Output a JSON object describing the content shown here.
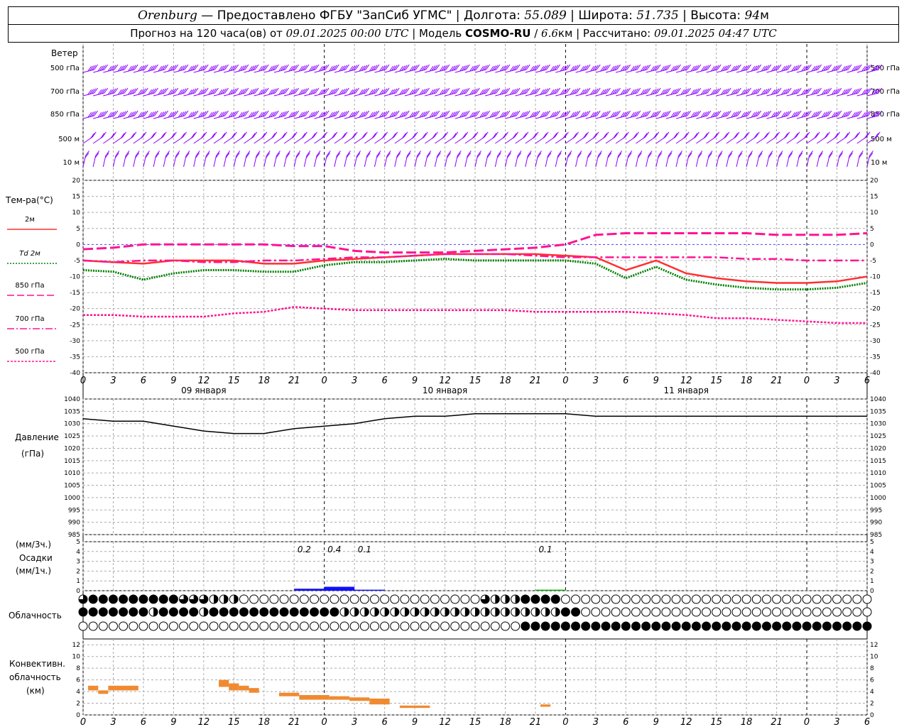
{
  "header": {
    "city": "Orenburg",
    "dash": " — ",
    "provider": "Предоставлено ФГБУ \"ЗапСиб УГМС\"",
    "sep": " | ",
    "lon_label": "Долгота: ",
    "lon": "55.089",
    "lat_label": "Широта: ",
    "lat": "51.735",
    "alt_label": "Высота: ",
    "alt": "94",
    "alt_unit": "м",
    "forecast_label": "Прогноз на 120 часа(ов) от ",
    "forecast_from": "09.01.2025 00:00 UTC",
    "model_label": " | Модель ",
    "model": "COSMO-RU",
    "model_slash": " / ",
    "model_res": "6.6",
    "model_res_unit": "км",
    "calc_label": " | Рассчитано: ",
    "calc_time": "09.01.2025 04:47 UTC"
  },
  "wind_panel": {
    "title": "Ветер",
    "levels": [
      "500 гПа",
      "700 гПа",
      "850 гПа",
      "500 м",
      "10   м"
    ],
    "color": "#8b00ff"
  },
  "temp_panel": {
    "title": "Тем-ра(°C)",
    "legend": [
      {
        "label": "2м",
        "color": "#ff3030",
        "style": "solid"
      },
      {
        "label": "Td  2м",
        "color": "#008000",
        "style": "dotted"
      },
      {
        "label": "850 гПа",
        "color": "#ff1493",
        "style": "longdash"
      },
      {
        "label": "700 гПа",
        "color": "#ff1493",
        "style": "dashdot"
      },
      {
        "label": "500 гПа",
        "color": "#ff1493",
        "style": "dense"
      }
    ],
    "yticks": [
      20,
      15,
      10,
      5,
      0,
      -5,
      -10,
      -15,
      -20,
      -25,
      -30,
      -35,
      -40
    ],
    "day_labels": [
      "09 января",
      "10 января",
      "11 января"
    ]
  },
  "pressure_panel": {
    "title": "Давление",
    "unit": "(гПа)",
    "yticks": [
      1040,
      1035,
      1030,
      1025,
      1020,
      1015,
      1010,
      1005,
      1000,
      995,
      990,
      985
    ]
  },
  "precip_panel": {
    "unit3": "(мм/3ч.)",
    "title": "Осадки",
    "unit1": "(мм/1ч.)",
    "yticks": [
      5,
      4,
      3,
      2,
      1,
      0
    ],
    "annotations": [
      {
        "hour": 22,
        "text": "0.2"
      },
      {
        "hour": 25,
        "text": "0.4"
      },
      {
        "hour": 28,
        "text": "0.1"
      },
      {
        "hour": 46,
        "text": "0.1"
      }
    ]
  },
  "cloud_panel": {
    "title": "Облачность"
  },
  "conv_panel": {
    "title1": "Конвективн.",
    "title2": "облачность",
    "unit": "(км)",
    "yticks": [
      12,
      10,
      8,
      6,
      4,
      2,
      0
    ]
  },
  "xaxis": {
    "tick_labels": [
      "0",
      "3",
      "6",
      "9",
      "12",
      "15",
      "18",
      "21",
      "0",
      "3",
      "6",
      "9",
      "12",
      "15",
      "18",
      "21",
      "0",
      "3",
      "6",
      "9",
      "12",
      "15",
      "18",
      "21",
      "0",
      "3",
      "6"
    ]
  },
  "chart_data": {
    "type": "line",
    "x_hours": [
      0,
      3,
      6,
      9,
      12,
      15,
      18,
      21,
      24,
      27,
      30,
      33,
      36,
      39,
      42,
      45,
      48,
      51,
      54,
      57,
      60,
      63,
      66,
      69,
      72,
      75,
      78
    ],
    "series": [
      {
        "name": "2м",
        "values": [
          -5,
          -5.5,
          -6,
          -5,
          -5,
          -5,
          -6,
          -6,
          -5,
          -4.5,
          -4,
          -3.5,
          -3,
          -3,
          -3,
          -3,
          -3.5,
          -4,
          -8,
          -5,
          -9,
          -10.5,
          -11.5,
          -12,
          -12,
          -11.5,
          -10
        ]
      },
      {
        "name": "Td  2м",
        "values": [
          -8,
          -8.5,
          -11,
          -9,
          -8,
          -8,
          -8.5,
          -8.5,
          -6.5,
          -5.5,
          -5.5,
          -5,
          -4.5,
          -5,
          -5,
          -5,
          -5,
          -6,
          -10.5,
          -7,
          -11,
          -12.5,
          -13.5,
          -14,
          -14,
          -13.5,
          -12
        ]
      },
      {
        "name": "850 гПа",
        "values": [
          -1.5,
          -1,
          0,
          0,
          0,
          0,
          0,
          -0.5,
          -0.5,
          -2,
          -2.5,
          -2.5,
          -2.5,
          -2,
          -1.5,
          -1,
          0,
          3,
          3.5,
          3.5,
          3.5,
          3.5,
          3.5,
          3,
          3,
          3,
          3.5
        ]
      },
      {
        "name": "700 гПа",
        "values": [
          -5,
          -5.5,
          -5,
          -5,
          -5.5,
          -5.5,
          -5,
          -5,
          -4.5,
          -4,
          -4,
          -3.5,
          -3,
          -3,
          -3,
          -3.5,
          -4,
          -4,
          -4,
          -4,
          -4,
          -4,
          -4.5,
          -4.5,
          -5,
          -5,
          -5
        ]
      },
      {
        "name": "500 гПа",
        "values": [
          -22,
          -22,
          -22.5,
          -22.5,
          -22.5,
          -21.5,
          -21,
          -19.5,
          -20,
          -20.5,
          -20.5,
          -20.5,
          -20.5,
          -20.5,
          -20.5,
          -21,
          -21,
          -21,
          -21,
          -21.5,
          -22,
          -23,
          -23,
          -23.5,
          -24,
          -24.5,
          -24.5
        ]
      },
      {
        "name": "Давление",
        "values": [
          1032,
          1031,
          1031,
          1029,
          1027,
          1026,
          1026,
          1028,
          1029,
          1030,
          1032,
          1033,
          1033,
          1034,
          1034,
          1034,
          1034,
          1033,
          1033,
          1033,
          1033,
          1033,
          1033,
          1033,
          1033,
          1033,
          1033
        ]
      }
    ],
    "precip": [
      {
        "hour_from": 21,
        "hour_to": 24,
        "value": 0.2,
        "color": "#1010ff"
      },
      {
        "hour_from": 24,
        "hour_to": 27,
        "value": 0.4,
        "color": "#1010ff"
      },
      {
        "hour_from": 27,
        "hour_to": 30,
        "value": 0.1,
        "color": "#1010ff"
      },
      {
        "hour_from": 45,
        "hour_to": 48,
        "value": 0.1,
        "color": "#00b000"
      }
    ],
    "convective": [
      {
        "hour_from": 0.5,
        "hour_to": 1.5,
        "bottom": 4.2,
        "top": 5
      },
      {
        "hour_from": 1.5,
        "hour_to": 2.5,
        "bottom": 3.6,
        "top": 4.2
      },
      {
        "hour_from": 2.5,
        "hour_to": 5.5,
        "bottom": 4.2,
        "top": 5
      },
      {
        "hour_from": 13.5,
        "hour_to": 14.5,
        "bottom": 4.8,
        "top": 6
      },
      {
        "hour_from": 14.5,
        "hour_to": 15.5,
        "bottom": 4.2,
        "top": 5.4
      },
      {
        "hour_from": 15.5,
        "hour_to": 16.5,
        "bottom": 4.2,
        "top": 5
      },
      {
        "hour_from": 16.5,
        "hour_to": 17.5,
        "bottom": 3.8,
        "top": 4.6
      },
      {
        "hour_from": 19.5,
        "hour_to": 21.5,
        "bottom": 3.2,
        "top": 3.8
      },
      {
        "hour_from": 21.5,
        "hour_to": 24.5,
        "bottom": 2.6,
        "top": 3.4
      },
      {
        "hour_from": 24.5,
        "hour_to": 26.5,
        "bottom": 2.6,
        "top": 3.2
      },
      {
        "hour_from": 26.5,
        "hour_to": 28.5,
        "bottom": 2.4,
        "top": 3
      },
      {
        "hour_from": 28.5,
        "hour_to": 29.5,
        "bottom": 1.8,
        "top": 2.8
      },
      {
        "hour_from": 29.5,
        "hour_to": 30.5,
        "bottom": 1.8,
        "top": 2.8
      },
      {
        "hour_from": 31.5,
        "hour_to": 34.5,
        "bottom": 1.2,
        "top": 1.6
      },
      {
        "hour_from": 45.5,
        "hour_to": 46.5,
        "bottom": 1.4,
        "top": 1.8
      }
    ],
    "cloud_rows": [
      "3111111111333222000000000000000000000000322211110000000000000000000000000000000000003311132221100000000000000000000000000000000000000000000000000000000000",
      "111111121111211111111111112222222222222222222222110000000000000000000000000000000000000000300000000000000000000000000000000000000000000000000000000000000",
      "000000000000000000000000000000000000000000001111111111111111111111111111111111111111111111111111111100000000000000000000000000000000000000000000000000000000"
    ],
    "xlim_hours": [
      0,
      78
    ],
    "temp_ylim": [
      -40,
      20
    ],
    "pressure_ylim": [
      985,
      1040
    ],
    "precip_ylim": [
      0,
      5
    ],
    "conv_ylim": [
      0,
      13
    ],
    "wind_direction": "северо-западный — западный",
    "grid": true
  }
}
